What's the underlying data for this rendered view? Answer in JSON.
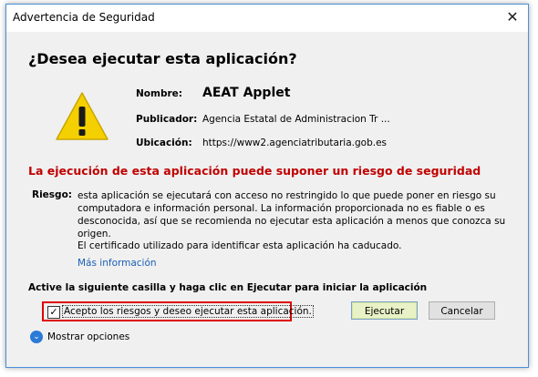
{
  "window": {
    "title": "Advertencia de Seguridad",
    "close_glyph": "✕"
  },
  "heading": "¿Desea ejecutar esta aplicación?",
  "icon": {
    "name": "warning-icon",
    "color": "#f5d000"
  },
  "fields": [
    {
      "label": "Nombre:",
      "value": "AEAT Applet"
    },
    {
      "label": "Publicador:",
      "value": "Agencia Estatal de Administracion Tr ..."
    },
    {
      "label": "Ubicación:",
      "value": "https://www2.agenciatributaria.gob.es"
    }
  ],
  "risk": {
    "heading": "La ejecución de esta aplicación puede suponer un riesgo de seguridad",
    "label": "Riesgo:",
    "text": "esta aplicación se ejecutará con acceso no restringido lo que puede poner en riesgo su computadora e información personal. La información proporcionada no es fiable o es desconocida, así que se recomienda no ejecutar esta aplicación a menos que conozca su origen.",
    "certificate": "El certificado utilizado para identificar esta aplicación ha caducado.",
    "more_info": "Más información"
  },
  "instruction": "Active la siguiente casilla y haga clic en Ejecutar para iniciar la aplicación",
  "accept": {
    "checked": true,
    "check_glyph": "✓",
    "label": "Acepto los riesgos y deseo ejecutar esta aplicación."
  },
  "buttons": {
    "run": "Ejecutar",
    "cancel": "Cancelar"
  },
  "options": {
    "label": "Mostrar opciones",
    "chevron_glyph": "⌄"
  },
  "colors": {
    "risk_heading": "#c00000",
    "highlight_border": "#e00000",
    "link": "#1a5fb4"
  }
}
